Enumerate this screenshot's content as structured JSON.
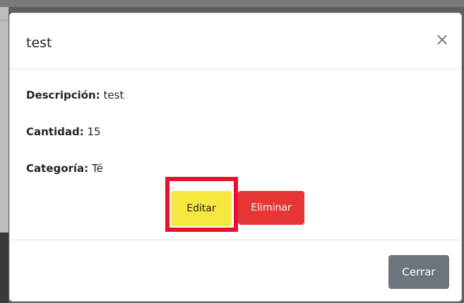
{
  "modal": {
    "title": "test",
    "close_icon": "×",
    "close_icon_name": "close-icon",
    "fields": {
      "descripcion": {
        "label": "Descripción:",
        "value": "test"
      },
      "cantidad": {
        "label": "Cantidad:",
        "value": "15"
      },
      "categoria": {
        "label": "Categoría:",
        "value": "Té"
      }
    },
    "actions": {
      "edit_label": "Editar",
      "delete_label": "Eliminar"
    },
    "footer": {
      "close_label": "Cerrar"
    }
  },
  "colors": {
    "edit_button": "#f7e83f",
    "delete_button": "#e53535",
    "close_button": "#6c757d",
    "highlight_border": "#e8112d"
  }
}
